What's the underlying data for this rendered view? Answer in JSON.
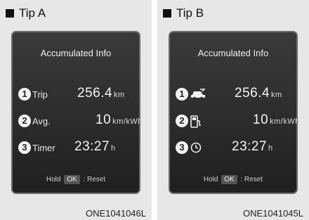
{
  "tip_a": {
    "title": "Tip A",
    "screen_title": "Accumulated Info",
    "rows": [
      {
        "num": "1",
        "label": "Trip",
        "value": "256.4",
        "unit": "km"
      },
      {
        "num": "2",
        "label": "Avg.",
        "value": "10",
        "unit": "km/kWh"
      },
      {
        "num": "3",
        "label": "Timer",
        "value": "23:27",
        "unit": "h"
      }
    ],
    "footer": {
      "hold": "Hold",
      "ok": "OK",
      "reset": ": Reset"
    },
    "code": "ONE1041046L"
  },
  "tip_b": {
    "title": "Tip B",
    "screen_title": "Accumulated Info",
    "rows": [
      {
        "num": "1",
        "icon": "car-trip-icon",
        "value": "256.4",
        "unit": "km"
      },
      {
        "num": "2",
        "icon": "charging-station-icon",
        "value": "10",
        "unit": "km/kWh"
      },
      {
        "num": "3",
        "icon": "clock-icon",
        "value": "23:27",
        "unit": "h"
      }
    ],
    "footer": {
      "hold": "Hold",
      "ok": "OK",
      "reset": ": Reset"
    },
    "code": "ONE1041045L"
  }
}
